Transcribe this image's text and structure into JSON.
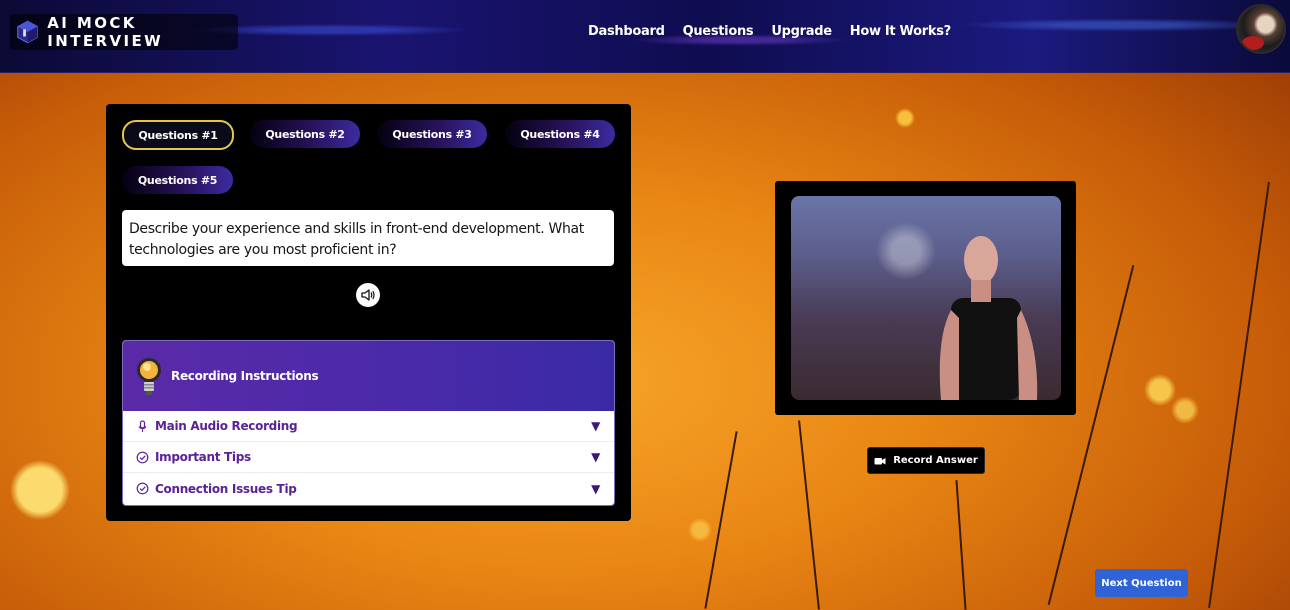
{
  "header": {
    "logo_text": "AI MOCK INTERVIEW",
    "nav": [
      {
        "label": "Dashboard"
      },
      {
        "label": "Questions"
      },
      {
        "label": "Upgrade"
      },
      {
        "label": "How It Works?"
      }
    ]
  },
  "questions": {
    "tabs": [
      {
        "label": "Questions #1",
        "active": true
      },
      {
        "label": "Questions #2",
        "active": false
      },
      {
        "label": "Questions #3",
        "active": false
      },
      {
        "label": "Questions #4",
        "active": false
      },
      {
        "label": "Questions #5",
        "active": false
      }
    ],
    "current_text": "Describe your experience and skills in front-end development. What technologies are you most proficient in?"
  },
  "instructions": {
    "title": "Recording Instructions",
    "items": [
      {
        "label": "Main Audio Recording",
        "icon": "microphone-icon"
      },
      {
        "label": "Important Tips",
        "icon": "check-circle-icon"
      },
      {
        "label": "Connection Issues Tip",
        "icon": "check-circle-icon"
      }
    ]
  },
  "actions": {
    "record_label": "Record Answer",
    "next_label": "Next Question"
  },
  "colors": {
    "accent": "#2f63d6",
    "active_tab_border": "#e6c64a",
    "instructions_header": "#4a2aa8",
    "instruction_text": "#5b2196"
  }
}
